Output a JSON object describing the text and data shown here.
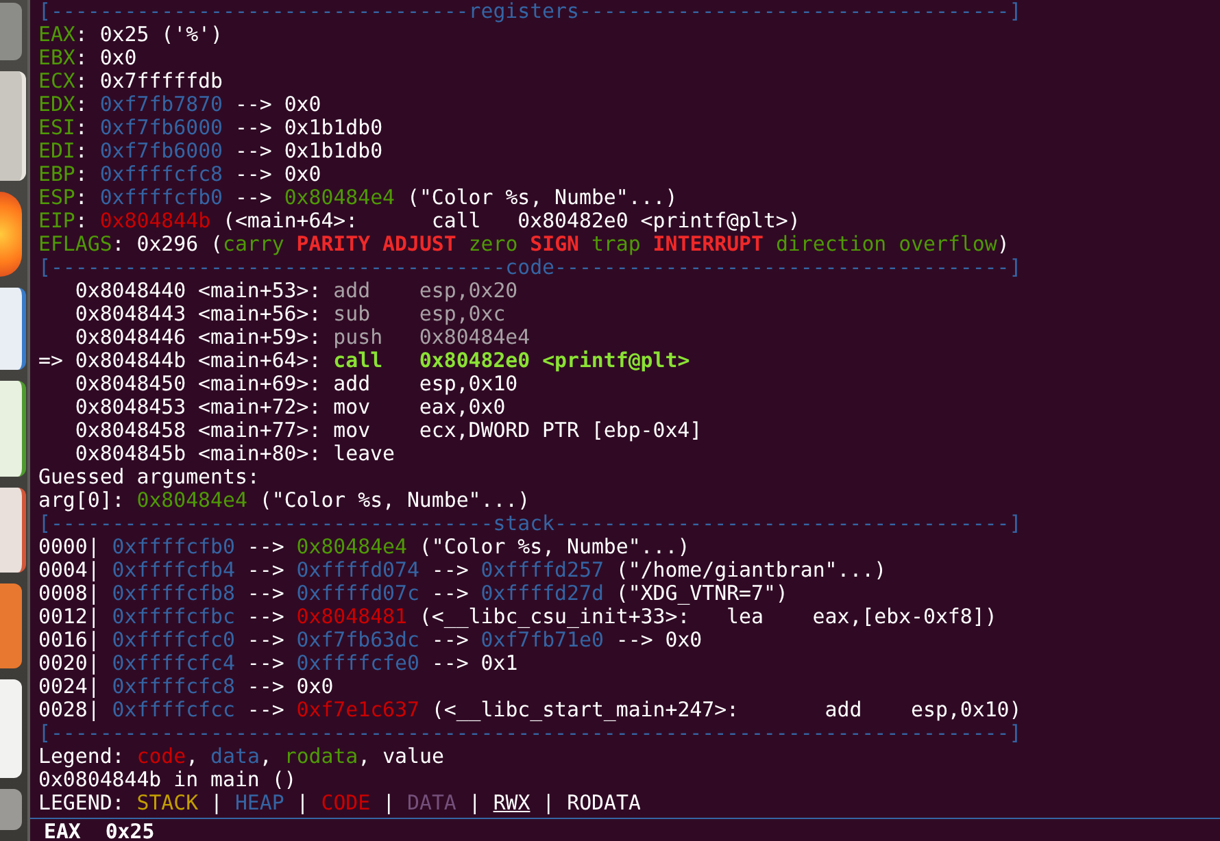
{
  "terminal": {
    "lines": [
      [
        {
          "kind": "rule",
          "text": "[----------------------------------registers-----------------------------------]"
        }
      ],
      [
        {
          "kind": "reg",
          "text": "EAX"
        },
        {
          "kind": "plain",
          "text": ": 0x25 ('%')"
        }
      ],
      [
        {
          "kind": "reg",
          "text": "EBX"
        },
        {
          "kind": "plain",
          "text": ": 0x0"
        }
      ],
      [
        {
          "kind": "reg",
          "text": "ECX"
        },
        {
          "kind": "plain",
          "text": ": 0x7fffffdb"
        }
      ],
      [
        {
          "kind": "reg",
          "text": "EDX"
        },
        {
          "kind": "plain",
          "text": ": "
        },
        {
          "kind": "ptr",
          "text": "0xf7fb7870"
        },
        {
          "kind": "plain",
          "text": " --> 0x0"
        }
      ],
      [
        {
          "kind": "reg",
          "text": "ESI"
        },
        {
          "kind": "plain",
          "text": ": "
        },
        {
          "kind": "ptr",
          "text": "0xf7fb6000"
        },
        {
          "kind": "plain",
          "text": " --> 0x1b1db0"
        }
      ],
      [
        {
          "kind": "reg",
          "text": "EDI"
        },
        {
          "kind": "plain",
          "text": ": "
        },
        {
          "kind": "ptr",
          "text": "0xf7fb6000"
        },
        {
          "kind": "plain",
          "text": " --> 0x1b1db0"
        }
      ],
      [
        {
          "kind": "reg",
          "text": "EBP"
        },
        {
          "kind": "plain",
          "text": ": "
        },
        {
          "kind": "ptr",
          "text": "0xffffcfc8"
        },
        {
          "kind": "plain",
          "text": " --> 0x0"
        }
      ],
      [
        {
          "kind": "reg",
          "text": "ESP"
        },
        {
          "kind": "plain",
          "text": ": "
        },
        {
          "kind": "ptr",
          "text": "0xffffcfb0"
        },
        {
          "kind": "plain",
          "text": " --> "
        },
        {
          "kind": "rodata",
          "text": "0x80484e4"
        },
        {
          "kind": "plain",
          "text": " (\"Color %s, Numbe\"...)"
        }
      ],
      [
        {
          "kind": "reg",
          "text": "EIP"
        },
        {
          "kind": "plain",
          "text": ": "
        },
        {
          "kind": "code",
          "text": "0x804844b"
        },
        {
          "kind": "plain",
          "text": " (<main+64>:      call   0x80482e0 <printf@plt>)"
        }
      ],
      [
        {
          "kind": "reg",
          "text": "EFLAGS"
        },
        {
          "kind": "plain",
          "text": ": 0x296 ("
        },
        {
          "kind": "flag_off",
          "text": "carry "
        },
        {
          "kind": "flag_on",
          "text": "PARITY "
        },
        {
          "kind": "flag_on",
          "text": "ADJUST "
        },
        {
          "kind": "flag_off",
          "text": "zero "
        },
        {
          "kind": "flag_on",
          "text": "SIGN "
        },
        {
          "kind": "flag_off",
          "text": "trap "
        },
        {
          "kind": "flag_on",
          "text": "INTERRUPT "
        },
        {
          "kind": "flag_off",
          "text": "direction "
        },
        {
          "kind": "flag_off",
          "text": "overflow"
        },
        {
          "kind": "plain",
          "text": ")"
        }
      ],
      [
        {
          "kind": "rule",
          "text": "[-------------------------------------code-------------------------------------]"
        }
      ],
      [
        {
          "kind": "plain",
          "text": "   0x8048440 <main+53>: "
        },
        {
          "kind": "dim",
          "text": "add    esp,0x20"
        }
      ],
      [
        {
          "kind": "plain",
          "text": "   0x8048443 <main+56>: "
        },
        {
          "kind": "dim",
          "text": "sub    esp,0xc"
        }
      ],
      [
        {
          "kind": "plain",
          "text": "   0x8048446 <main+59>: "
        },
        {
          "kind": "dim",
          "text": "push   0x80484e4"
        }
      ],
      [
        {
          "kind": "plain",
          "text": "=> 0x804844b <main+64>: "
        },
        {
          "kind": "current",
          "text": "call   0x80482e0 <printf@plt>"
        }
      ],
      [
        {
          "kind": "plain",
          "text": "   0x8048450 <main+69>: add    esp,0x10"
        }
      ],
      [
        {
          "kind": "plain",
          "text": "   0x8048453 <main+72>: mov    eax,0x0"
        }
      ],
      [
        {
          "kind": "plain",
          "text": "   0x8048458 <main+77>: mov    ecx,DWORD PTR [ebp-0x4]"
        }
      ],
      [
        {
          "kind": "plain",
          "text": "   0x804845b <main+80>: leave"
        }
      ],
      [
        {
          "kind": "plain",
          "text": "Guessed arguments:"
        }
      ],
      [
        {
          "kind": "plain",
          "text": "arg[0]: "
        },
        {
          "kind": "rodata",
          "text": "0x80484e4"
        },
        {
          "kind": "plain",
          "text": " (\"Color %s, Numbe\"...)"
        }
      ],
      [
        {
          "kind": "rule",
          "text": "[------------------------------------stack-------------------------------------]"
        }
      ],
      [
        {
          "kind": "plain",
          "text": "0000| "
        },
        {
          "kind": "ptr",
          "text": "0xffffcfb0"
        },
        {
          "kind": "plain",
          "text": " --> "
        },
        {
          "kind": "rodata",
          "text": "0x80484e4"
        },
        {
          "kind": "plain",
          "text": " (\"Color %s, Numbe\"...)"
        }
      ],
      [
        {
          "kind": "plain",
          "text": "0004| "
        },
        {
          "kind": "ptr",
          "text": "0xffffcfb4"
        },
        {
          "kind": "plain",
          "text": " --> "
        },
        {
          "kind": "ptr",
          "text": "0xffffd074"
        },
        {
          "kind": "plain",
          "text": " --> "
        },
        {
          "kind": "ptr",
          "text": "0xffffd257"
        },
        {
          "kind": "plain",
          "text": " (\"/home/giantbran\"...)"
        }
      ],
      [
        {
          "kind": "plain",
          "text": "0008| "
        },
        {
          "kind": "ptr",
          "text": "0xffffcfb8"
        },
        {
          "kind": "plain",
          "text": " --> "
        },
        {
          "kind": "ptr",
          "text": "0xffffd07c"
        },
        {
          "kind": "plain",
          "text": " --> "
        },
        {
          "kind": "ptr",
          "text": "0xffffd27d"
        },
        {
          "kind": "plain",
          "text": " (\"XDG_VTNR=7\")"
        }
      ],
      [
        {
          "kind": "plain",
          "text": "0012| "
        },
        {
          "kind": "ptr",
          "text": "0xffffcfbc"
        },
        {
          "kind": "plain",
          "text": " --> "
        },
        {
          "kind": "code",
          "text": "0x8048481"
        },
        {
          "kind": "plain",
          "text": " (<__libc_csu_init+33>:   lea    eax,[ebx-0xf8])"
        }
      ],
      [
        {
          "kind": "plain",
          "text": "0016| "
        },
        {
          "kind": "ptr",
          "text": "0xffffcfc0"
        },
        {
          "kind": "plain",
          "text": " --> "
        },
        {
          "kind": "ptr",
          "text": "0xf7fb63dc"
        },
        {
          "kind": "plain",
          "text": " --> "
        },
        {
          "kind": "ptr",
          "text": "0xf7fb71e0"
        },
        {
          "kind": "plain",
          "text": " --> 0x0"
        }
      ],
      [
        {
          "kind": "plain",
          "text": "0020| "
        },
        {
          "kind": "ptr",
          "text": "0xffffcfc4"
        },
        {
          "kind": "plain",
          "text": " --> "
        },
        {
          "kind": "ptr",
          "text": "0xffffcfe0"
        },
        {
          "kind": "plain",
          "text": " --> 0x1"
        }
      ],
      [
        {
          "kind": "plain",
          "text": "0024| "
        },
        {
          "kind": "ptr",
          "text": "0xffffcfc8"
        },
        {
          "kind": "plain",
          "text": " --> 0x0"
        }
      ],
      [
        {
          "kind": "plain",
          "text": "0028| "
        },
        {
          "kind": "ptr",
          "text": "0xffffcfcc"
        },
        {
          "kind": "plain",
          "text": " --> "
        },
        {
          "kind": "code",
          "text": "0xf7e1c637"
        },
        {
          "kind": "plain",
          "text": " (<__libc_start_main+247>:       add    esp,0x10)"
        }
      ],
      [
        {
          "kind": "rule",
          "text": "[------------------------------------------------------------------------------]"
        }
      ],
      [
        {
          "kind": "plain",
          "text": "Legend: "
        },
        {
          "kind": "code",
          "text": "code"
        },
        {
          "kind": "plain",
          "text": ", "
        },
        {
          "kind": "ptr",
          "text": "data"
        },
        {
          "kind": "plain",
          "text": ", "
        },
        {
          "kind": "rodata",
          "text": "rodata"
        },
        {
          "kind": "plain",
          "text": ", value"
        }
      ],
      [
        {
          "kind": "plain",
          "text": "0x0804844b in main ()"
        }
      ],
      [
        {
          "kind": "plain",
          "text": "LEGEND: "
        },
        {
          "kind": "stack",
          "text": "STACK"
        },
        {
          "kind": "plain",
          "text": " | "
        },
        {
          "kind": "ptr",
          "text": "HEAP"
        },
        {
          "kind": "plain",
          "text": " | "
        },
        {
          "kind": "code",
          "text": "CODE"
        },
        {
          "kind": "plain",
          "text": " | "
        },
        {
          "kind": "data",
          "text": "DATA"
        },
        {
          "kind": "plain",
          "text": " | "
        },
        {
          "kind": "rwx",
          "text": "RWX"
        },
        {
          "kind": "plain",
          "text": " | RODATA"
        }
      ]
    ]
  },
  "watch_panel": {
    "lines": [
      "EAX  0x25"
    ]
  }
}
